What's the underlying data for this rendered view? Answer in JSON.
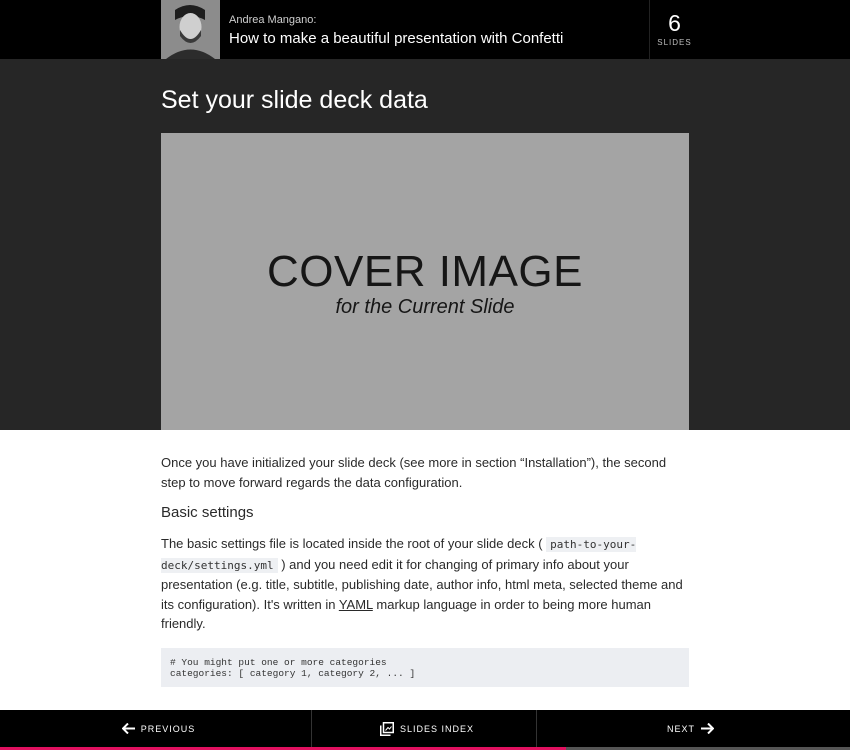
{
  "header": {
    "author": "Andrea Mangano:",
    "deck_title": "How to make a beautiful presentation with Confetti",
    "slide_count": "6",
    "slide_count_label": "SLIDES"
  },
  "slide": {
    "title": "Set your slide deck data",
    "cover_main": "COVER IMAGE",
    "cover_sub": "for the Current Slide"
  },
  "content": {
    "intro": "Once you have initialized your slide deck (see more in section “Installation”), the second step to move forward regards the data configuration.",
    "subheading": "Basic settings",
    "p2_before": "The basic settings file is located inside the root of your slide deck ( ",
    "p2_code": "path-to-your-deck/settings.yml",
    "p2_middle": " ) and you need edit it for changing of primary info about your presentation (e.g. title, subtitle, publishing date, author info, html meta, selected theme and its configuration). It's written in ",
    "p2_link": "YAML",
    "p2_after": " markup language in order to being more human friendly.",
    "code_block": "# You might put one or more categories\ncategories: [ category 1, category 2, ... ]"
  },
  "nav": {
    "previous": "PREVIOUS",
    "index": "SLIDES INDEX",
    "next": "NEXT",
    "progress": 0.666
  },
  "colors": {
    "progress": "#e0105f",
    "topbar": "#000000",
    "hero": "#262626"
  }
}
